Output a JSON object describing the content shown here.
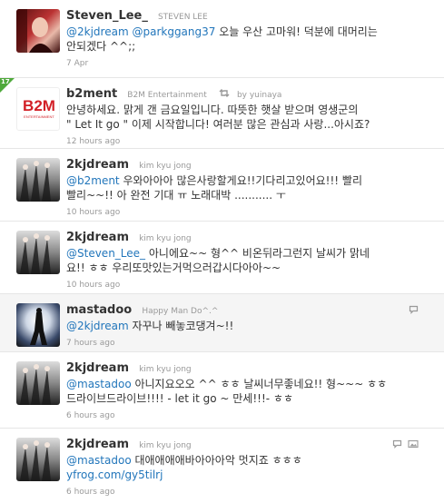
{
  "tweets": [
    {
      "screen_name": "Steven_Lee_",
      "full_name": "STEVEN LEE",
      "mentions": [
        "@2kjdream",
        "@parkggang37"
      ],
      "text_line1": " 오늘 우산 고마워! 덕분에 대머리는",
      "text_line2": "안되겠다 ^^;;",
      "time": "7 Apr"
    },
    {
      "screen_name": "b2ment",
      "full_name": "B2M Entertainment",
      "retweeted_by": "by yuinaya",
      "text_line1": "안녕하세요. 맑게 갠 금요일입니다. 따뜻한 햇살 받으며 영생군의",
      "text_line2": "\" Let It go \" 이제 시작합니다! 여러분 많은 관심과 사랑...아시죠?",
      "time": "12 hours ago",
      "logo_text": "B2M",
      "logo_sub": "ENTERTAINMENT"
    },
    {
      "screen_name": "2kjdream",
      "full_name": "kim kyu jong",
      "mention": "@b2ment",
      "text_line1": " 우와아아아 많은사랑할게요!!기다리고있어요!!! 빨리",
      "text_line2": "빨리~~!! 아 완전 기대 ㅠ 노래대박 ........... ㅜ",
      "time": "10 hours ago"
    },
    {
      "screen_name": "2kjdream",
      "full_name": "kim kyu jong",
      "mention": "@Steven_Lee_",
      "text_line1": "  아니에요~~ 형^^ 비온뒤라그런지 날씨가 맑네",
      "text_line2": "요!! ㅎㅎ 우리또맛있는거먹으러갑시다아아~~",
      "time": "10 hours ago"
    },
    {
      "screen_name": "mastadoo",
      "full_name": "Happy Man Do^.^",
      "mention": "@2kjdream",
      "text_line1": " 자꾸나 빼놓코댕겨~!!",
      "time": "7 hours ago"
    },
    {
      "screen_name": "2kjdream",
      "full_name": "kim kyu jong",
      "mention": "@mastadoo",
      "text_line1": " 아니지요오오 ^^ ㅎㅎ 날씨너무좋네요!! 형~~~ ㅎㅎ",
      "text_line2": "드라이브드라이브!!!! - let it go ~ 만세!!!- ㅎㅎ",
      "time": "6 hours ago"
    },
    {
      "screen_name": "2kjdream",
      "full_name": "kim kyu jong",
      "mention": "@mastadoo",
      "text_line1": " 대애애애애바아아아악 멋지죠 ㅎㅎㅎ",
      "link": "yfrog.com/gy5tilrj",
      "time": "6 hours ago"
    }
  ],
  "retweet_corner_label": "17",
  "colors": {
    "link": "#2276bb",
    "retweet_green": "#4fa93b",
    "muted": "#999999"
  }
}
